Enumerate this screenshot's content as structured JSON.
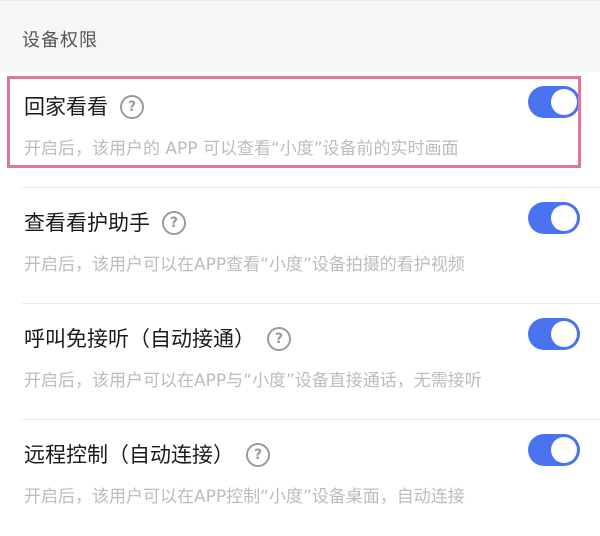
{
  "section": {
    "title": "设备权限"
  },
  "rows": [
    {
      "title": "回家看看",
      "help": "?",
      "desc": "开启后，该用户的 APP 可以查看“小度”设备前的实时画面",
      "enabled": true
    },
    {
      "title": "查看看护助手",
      "help": "?",
      "desc": "开启后，该用户可以在APP查看“小度”设备拍摄的看护视频",
      "enabled": true
    },
    {
      "title": "呼叫免接听（自动接通）",
      "help": "?",
      "desc": "开启后，该用户可以在APP与“小度”设备直接通话，无需接听",
      "enabled": true
    },
    {
      "title": "远程控制（自动连接）",
      "help": "?",
      "desc": "开启后，该用户可以在APP控制“小度”设备桌面，自动连接",
      "enabled": true
    }
  ],
  "colors": {
    "toggle_on": "#4a73ef",
    "highlight": "#e0779b",
    "desc_text": "#bcbcbc"
  }
}
